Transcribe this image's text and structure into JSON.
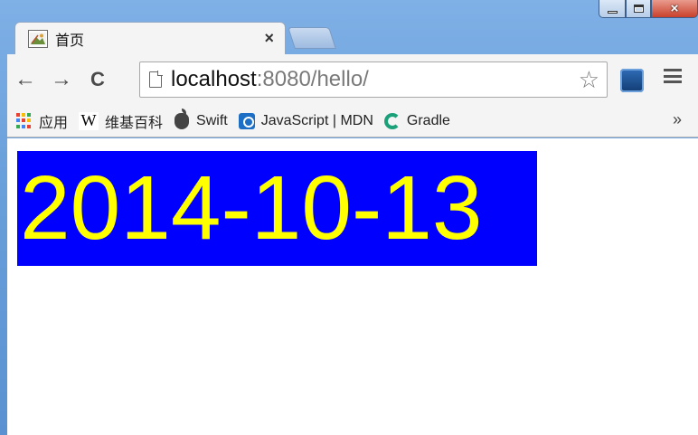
{
  "window": {
    "minimize_glyph": "minimize-icon",
    "maximize_glyph": "maximize-icon",
    "close_glyph": "×"
  },
  "tab": {
    "title": "首页",
    "close_label": "×",
    "favicon": "image-icon"
  },
  "toolbar": {
    "back_label": "←",
    "forward_label": "→",
    "reload_label": "C",
    "url_host": "localhost",
    "url_rest": ":8080/hello/",
    "star_label": "☆"
  },
  "bookmarks": {
    "items": [
      {
        "label": "应用",
        "icon": "apps-grid-icon"
      },
      {
        "label": "维基百科",
        "icon": "wikipedia-icon"
      },
      {
        "label": "Swift",
        "icon": "apple-icon"
      },
      {
        "label": "JavaScript | MDN",
        "icon": "mdn-icon"
      },
      {
        "label": "Gradle",
        "icon": "gradle-icon"
      }
    ],
    "more_label": "»"
  },
  "content": {
    "date_text": "2014-10-13",
    "background_color": "#0000ff",
    "text_color": "#ffff00"
  }
}
